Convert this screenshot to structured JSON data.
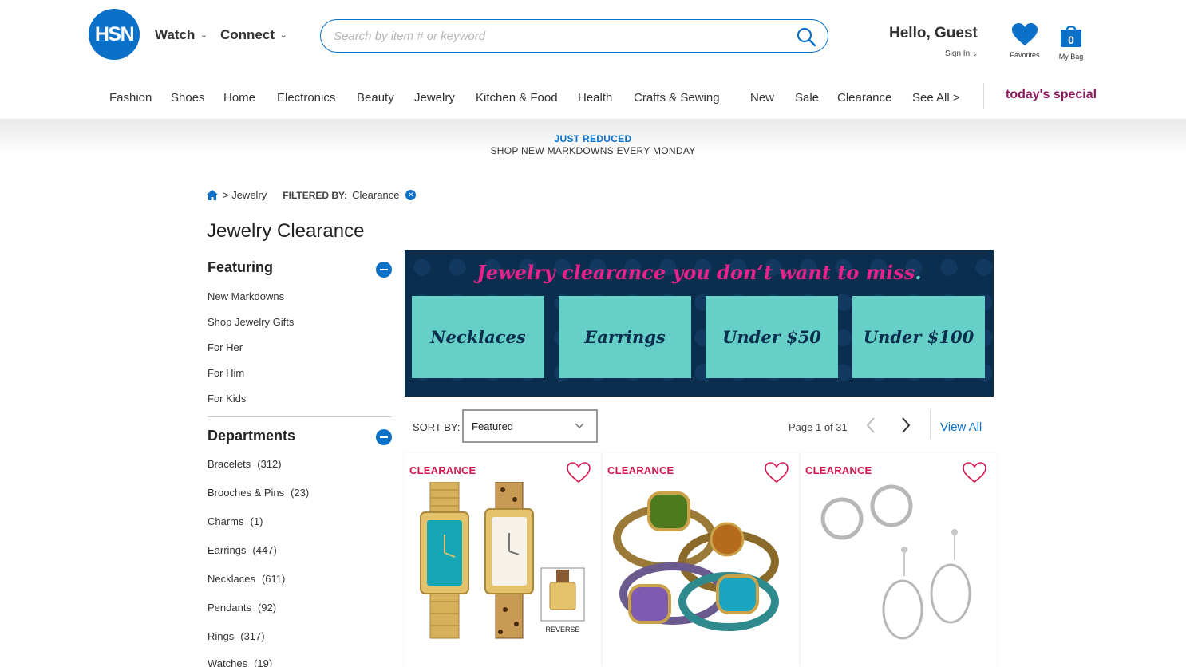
{
  "header": {
    "logo": "HSN",
    "nav": [
      {
        "label": "Watch"
      },
      {
        "label": "Connect"
      }
    ],
    "search_placeholder": "Search by item # or keyword",
    "greeting": "Hello, Guest",
    "signin": "Sign In",
    "favorites_label": "Favorites",
    "bag_label": "My Bag",
    "bag_count": "0"
  },
  "categories": [
    "Fashion",
    "Shoes",
    "Home",
    "Electronics",
    "Beauty",
    "Jewelry",
    "Kitchen & Food",
    "Health",
    "Crafts & Sewing",
    "New",
    "Sale",
    "Clearance",
    "See All >"
  ],
  "todays_special": "today's special",
  "promo": {
    "line1": "JUST REDUCED",
    "line2": "SHOP NEW MARKDOWNS EVERY MONDAY"
  },
  "breadcrumb": {
    "crumb": "> Jewelry",
    "filtered_label": "FILTERED BY:",
    "filter": "Clearance"
  },
  "page_title": "Jewelry Clearance",
  "sidebar": {
    "featuring_title": "Featuring",
    "featuring": [
      "New Markdowns",
      "Shop Jewelry Gifts",
      "For Her",
      "For Him",
      "For Kids"
    ],
    "departments_title": "Departments",
    "departments": [
      {
        "label": "Bracelets",
        "count": "(312)"
      },
      {
        "label": "Brooches & Pins",
        "count": "(23)"
      },
      {
        "label": "Charms",
        "count": "(1)"
      },
      {
        "label": "Earrings",
        "count": "(447)"
      },
      {
        "label": "Necklaces",
        "count": "(611)"
      },
      {
        "label": "Pendants",
        "count": "(92)"
      },
      {
        "label": "Rings",
        "count": "(317)"
      },
      {
        "label": "Watches",
        "count": "(19)"
      }
    ]
  },
  "banner": {
    "headline": "Jewelry clearance you don’t want to miss",
    "tiles": [
      "Necklaces",
      "Earrings",
      "Under $50",
      "Under $100"
    ]
  },
  "sort": {
    "label": "SORT BY:",
    "selected": "Featured",
    "page_info": "Page 1 of 31",
    "view_all": "View All"
  },
  "products": [
    {
      "badge": "CLEARANCE",
      "image_caption": "REVERSE"
    },
    {
      "badge": "CLEARANCE"
    },
    {
      "badge": "CLEARANCE"
    }
  ],
  "colors": {
    "brand_blue": "#0a70c8",
    "clearance_red": "#d6174f",
    "banner_navy": "#0b2d4e",
    "banner_teal": "#66cfc7",
    "banner_pink": "#e8228a",
    "special_purple": "#8b1a5c"
  }
}
